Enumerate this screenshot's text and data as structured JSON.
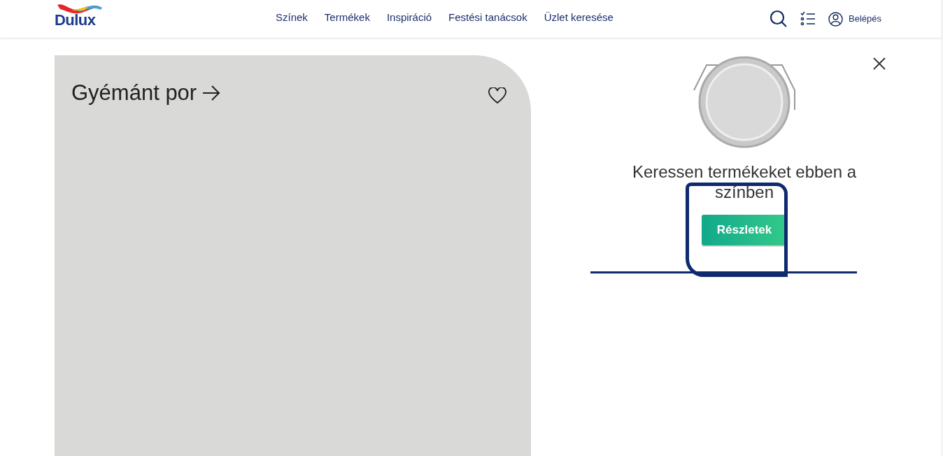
{
  "header": {
    "logo": "Dulux",
    "nav": [
      "Színek",
      "Termékek",
      "Inspiráció",
      "Festési tanácsok",
      "Üzlet keresése"
    ],
    "login": "Belépés"
  },
  "color_card": {
    "name": "Gyémánt por",
    "color": "#d9d9d8"
  },
  "panel": {
    "heading": "Keressen termékeket ebben a színben",
    "button": "Részletek"
  }
}
